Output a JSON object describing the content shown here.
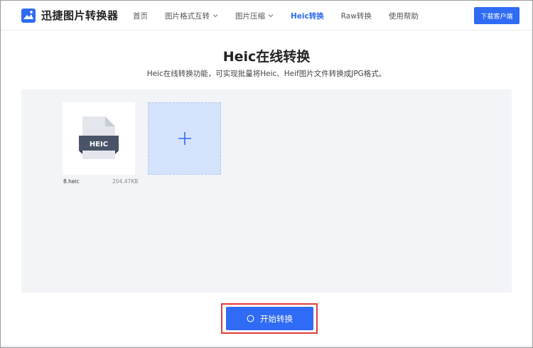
{
  "header": {
    "logo_text": "迅捷图片转换器",
    "nav": [
      {
        "label": "首页",
        "has_dropdown": false,
        "active": false
      },
      {
        "label": "图片格式互转",
        "has_dropdown": true,
        "active": false
      },
      {
        "label": "图片压缩",
        "has_dropdown": true,
        "active": false
      },
      {
        "label": "Heic转换",
        "has_dropdown": false,
        "active": true
      },
      {
        "label": "Raw转换",
        "has_dropdown": false,
        "active": false
      },
      {
        "label": "使用帮助",
        "has_dropdown": false,
        "active": false
      }
    ],
    "download_label": "下载客户端"
  },
  "main": {
    "title": "Heic在线转换",
    "subtitle": "Heic在线转换功能，可实现批量将Heic、Heif图片文件转换成JPG格式。",
    "file": {
      "icon_label": "HEIC",
      "name": "8.heic",
      "size": "204.47KB"
    },
    "start_label": "开始转换"
  },
  "colors": {
    "accent": "#2f6bf4",
    "highlight_outline": "#e23b3b",
    "upload_bg": "#f2f4f8",
    "add_tile_bg": "#d5e2fb"
  }
}
